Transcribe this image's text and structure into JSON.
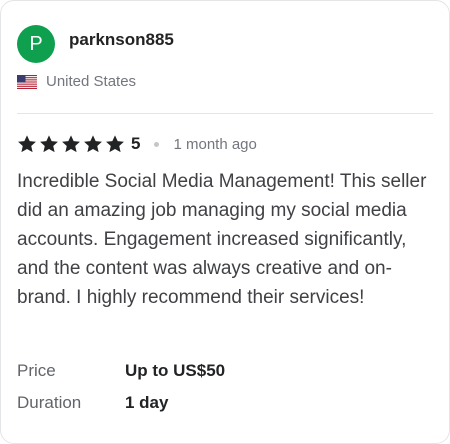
{
  "reviewer": {
    "avatar_letter": "P",
    "username": "parknson885",
    "country": "United States",
    "flag_icon": "us-flag-icon"
  },
  "review": {
    "stars": 5,
    "rating_label": "5",
    "time_ago": "1 month ago",
    "text": "Incredible Social Media Management! This seller did an amazing job managing my social media accounts. Engagement increased significantly, and the content was always creative and on-brand. I highly recommend their services!"
  },
  "details": {
    "price_label": "Price",
    "price_value": "Up to US$50",
    "duration_label": "Duration",
    "duration_value": "1 day"
  },
  "colors": {
    "avatar_bg": "#0e9f4f",
    "star": "#222325"
  }
}
